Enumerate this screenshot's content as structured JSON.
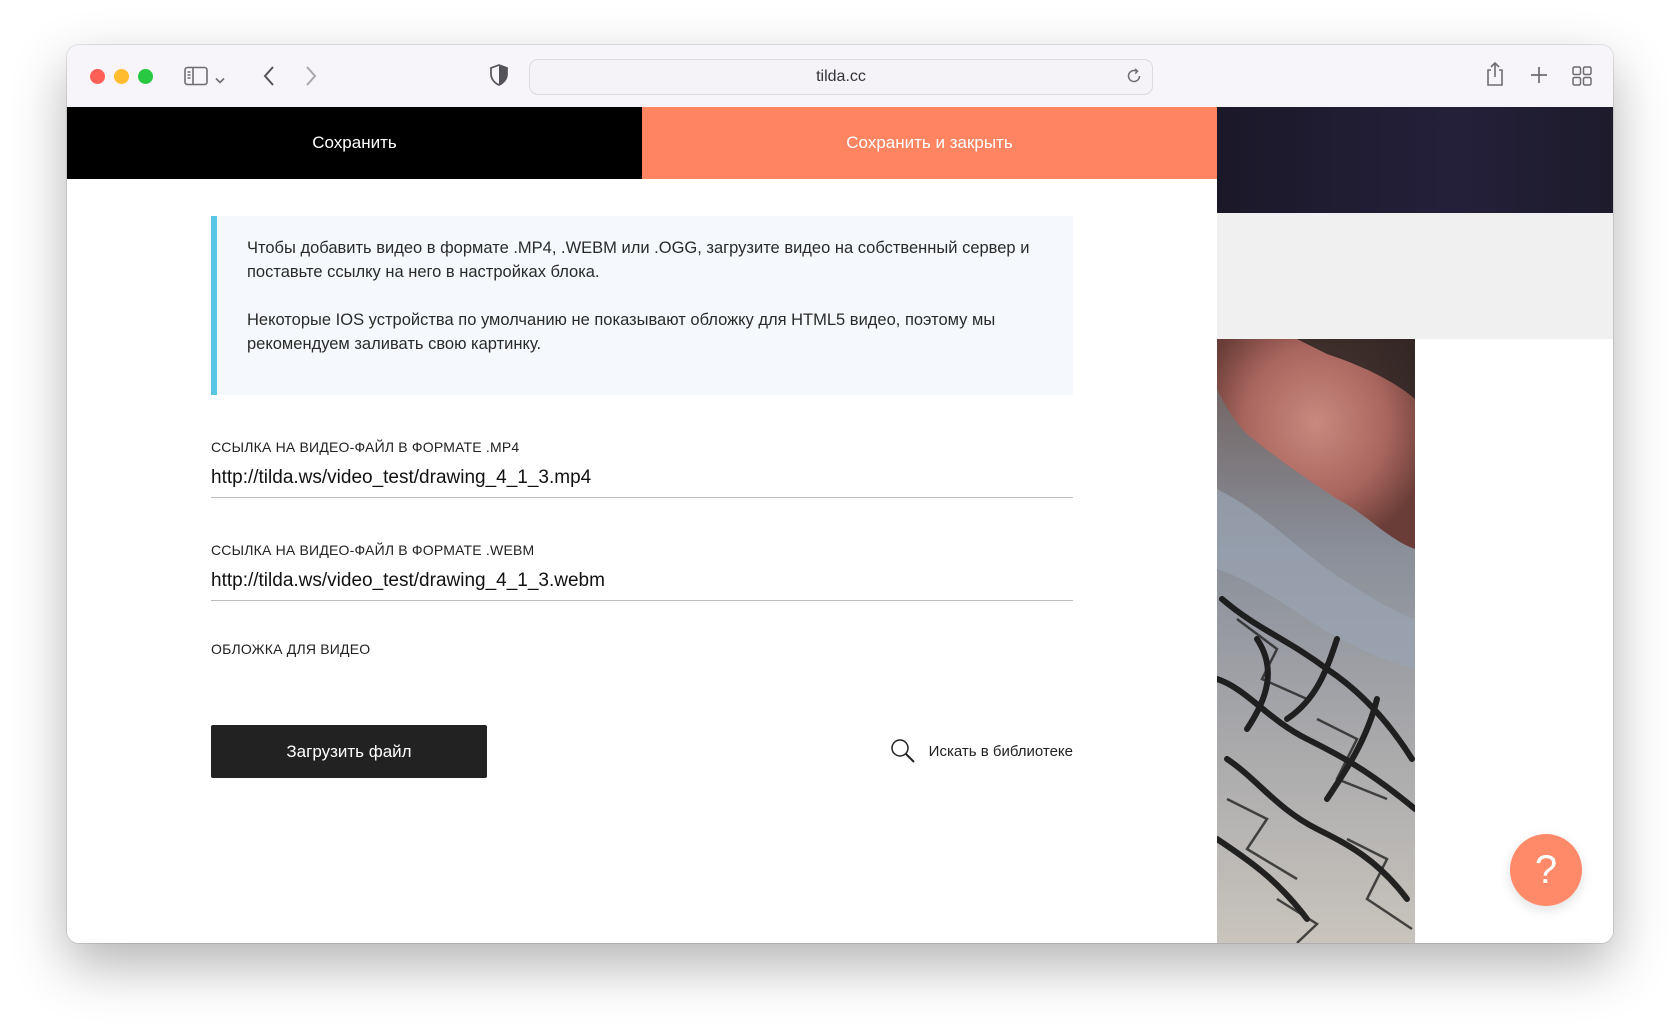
{
  "browser": {
    "url": "tilda.cc"
  },
  "toolbar": {
    "save_label": "Сохранить",
    "save_close_label": "Сохранить и закрыть"
  },
  "notice": {
    "paragraph1": "Чтобы добавить видео в формате .MP4, .WEBM или .OGG, загрузите видео на собственный сервер и поставьте ссылку на него в настройках блока.",
    "paragraph2": "Некоторые IOS устройства по умолчанию не показывают обложку для HTML5 видео, поэтому мы рекомендуем заливать свою картинку.",
    "accent_color": "#57c6e2"
  },
  "fields": {
    "mp4": {
      "label": "ССЫЛКА НА ВИДЕО-ФАЙЛ В ФОРМАТЕ .MP4",
      "value": "http://tilda.ws/video_test/drawing_4_1_3.mp4"
    },
    "webm": {
      "label": "ССЫЛКА НА ВИДЕО-ФАЙЛ В ФОРМАТЕ .WEBM",
      "value": "http://tilda.ws/video_test/drawing_4_1_3.webm"
    },
    "cover": {
      "label": "ОБЛОЖКА ДЛЯ ВИДЕО",
      "upload_label": "Загрузить файл",
      "library_label": "Искать в библиотеке"
    }
  },
  "help": {
    "label": "?"
  },
  "colors": {
    "save_bg": "#000000",
    "save_close_bg": "#ff8562",
    "upload_bg": "#222222",
    "help_bg": "#ff8a69"
  },
  "icons": {
    "sidebar": "sidebar-icon",
    "back": "chevron-left-icon",
    "forward": "chevron-right-icon",
    "privacy": "shield-icon",
    "reload": "reload-icon",
    "share": "share-icon",
    "new_tab": "plus-icon",
    "tab_overview": "tab-grid-icon",
    "search": "search-icon"
  }
}
